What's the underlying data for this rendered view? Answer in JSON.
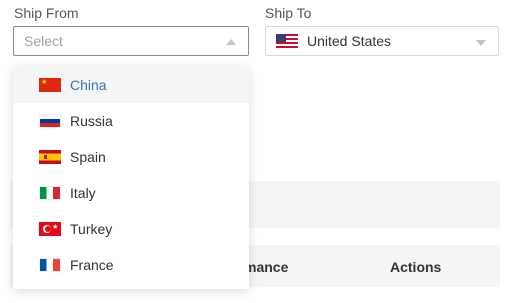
{
  "ship_from": {
    "label": "Ship From",
    "placeholder": "Select",
    "options": [
      {
        "name": "China",
        "flag": "china-flag-icon",
        "selected": true
      },
      {
        "name": "Russia",
        "flag": "russia-flag-icon",
        "selected": false
      },
      {
        "name": "Spain",
        "flag": "spain-flag-icon",
        "selected": false
      },
      {
        "name": "Italy",
        "flag": "italy-flag-icon",
        "selected": false
      },
      {
        "name": "Turkey",
        "flag": "turkey-flag-icon",
        "selected": false
      },
      {
        "name": "France",
        "flag": "france-flag-icon",
        "selected": false
      }
    ]
  },
  "ship_to": {
    "label": "Ship To",
    "value": "United States",
    "flag": "usa-flag-icon"
  },
  "table": {
    "col_performance_partial": "mance",
    "col_actions": "Actions"
  },
  "colors": {
    "selected_text": "#3c73a8",
    "selected_bg": "#f4f5f7",
    "row_bg": "#f5f5f5"
  }
}
